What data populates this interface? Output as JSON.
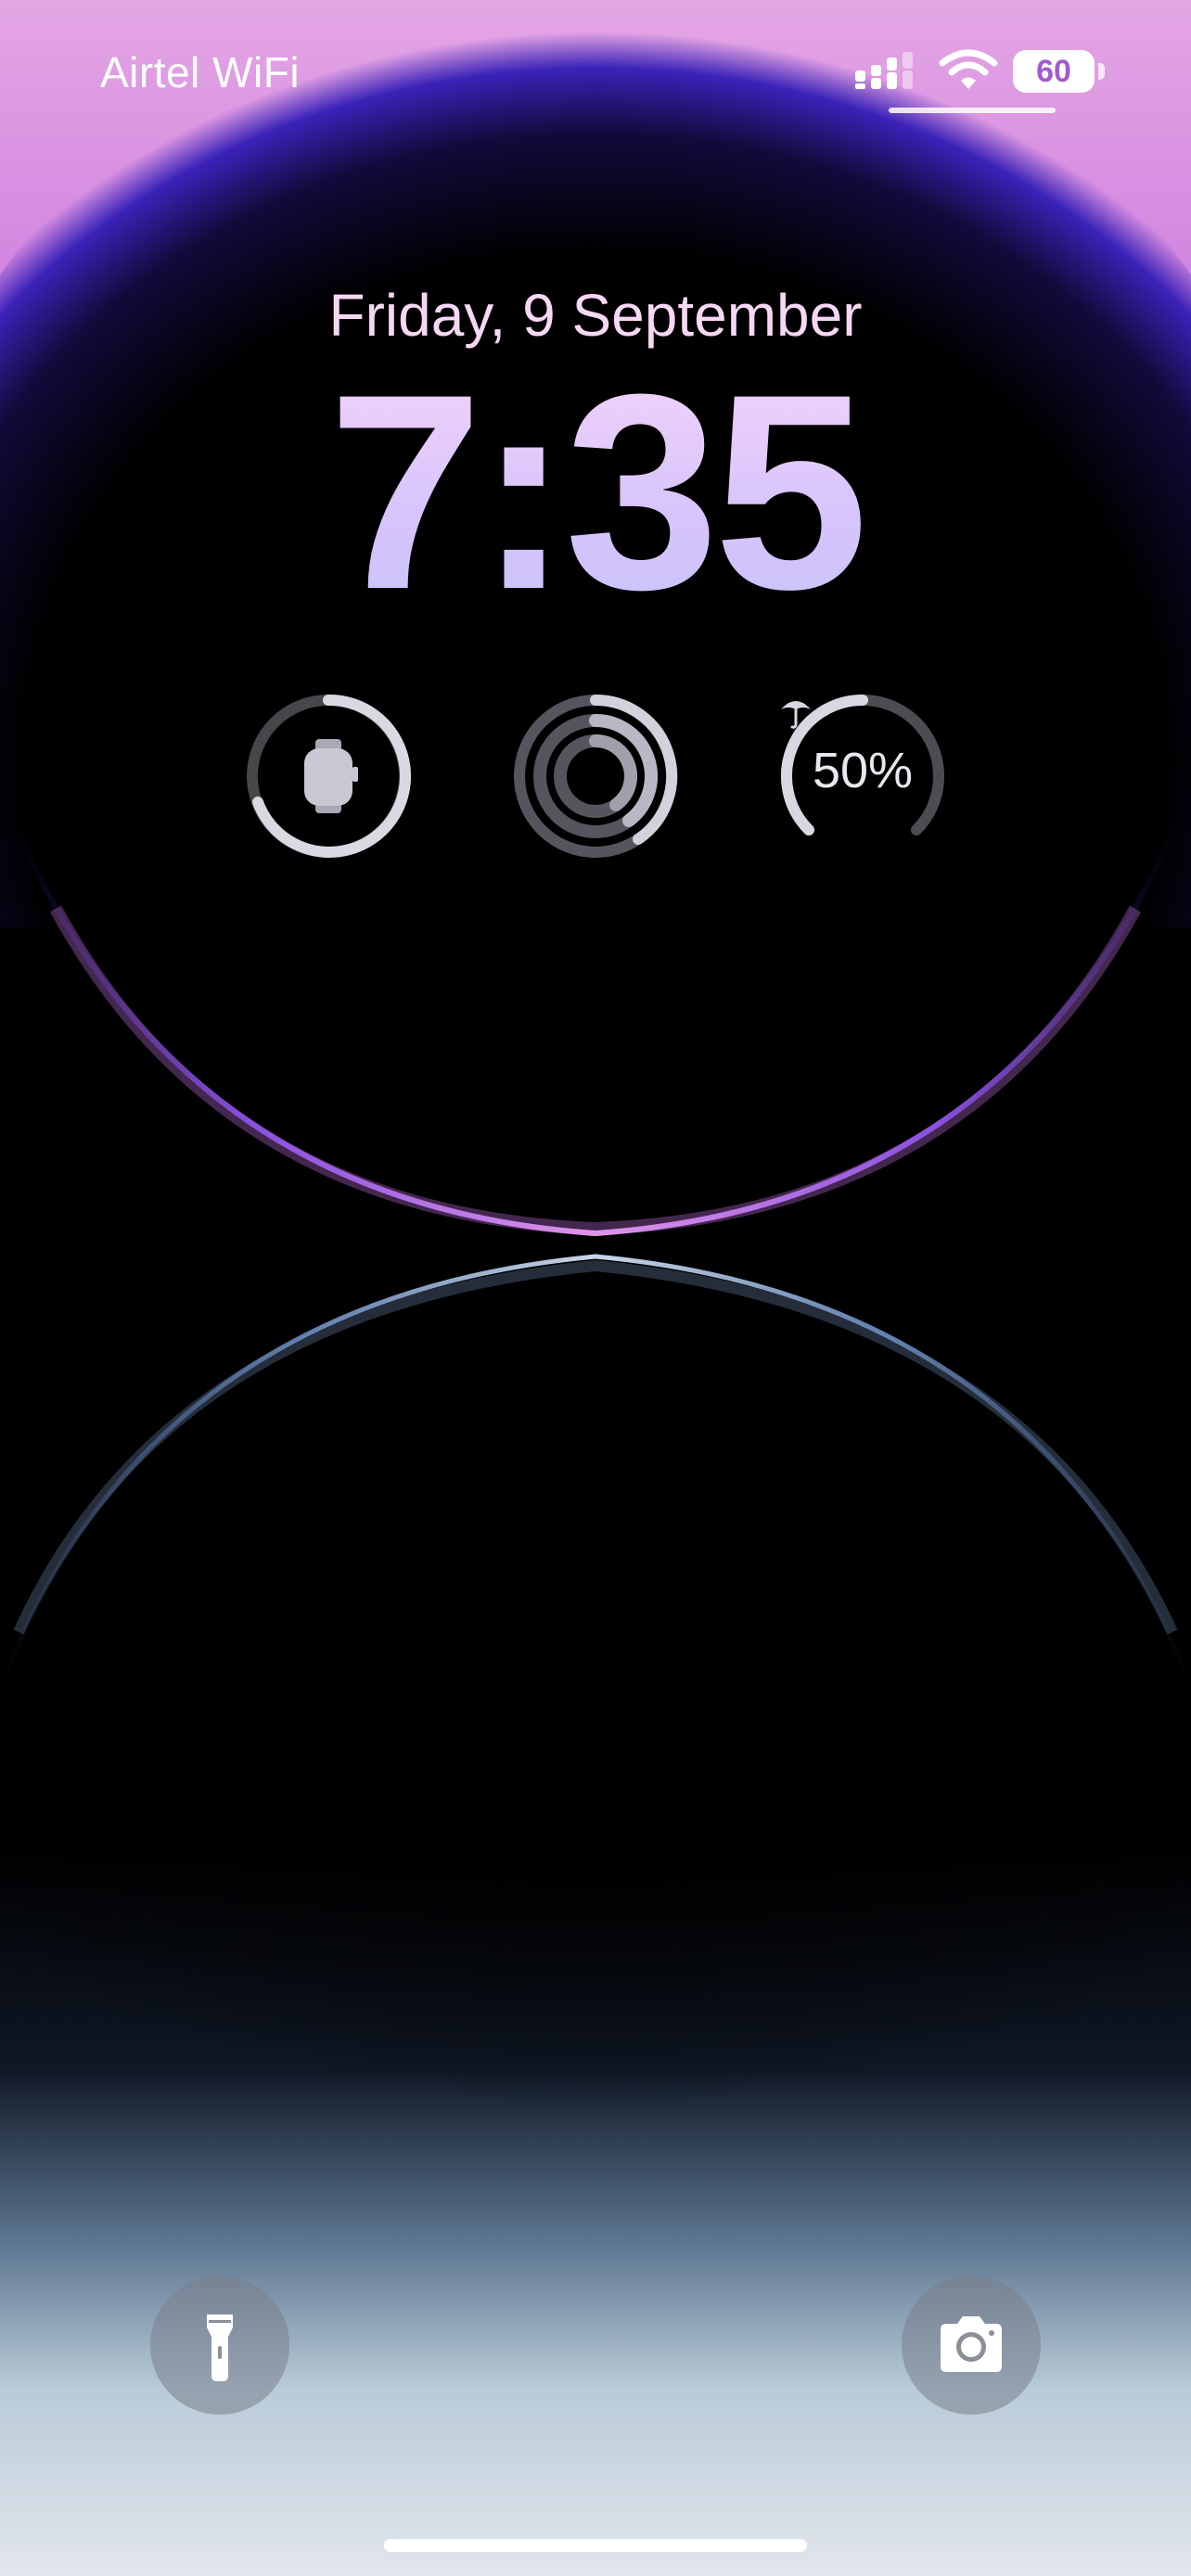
{
  "status_bar": {
    "carrier": "Airtel WiFi",
    "battery_level": "60",
    "icons": [
      "cellular-signal-icon",
      "wifi-icon",
      "battery-icon"
    ]
  },
  "lock_screen": {
    "date": "Friday, 9 September",
    "time": "7:35"
  },
  "widgets": [
    {
      "name": "watch-battery",
      "icon": "apple-watch-icon"
    },
    {
      "name": "activity-rings",
      "icon": "activity-rings-icon"
    },
    {
      "name": "rain-chance",
      "value": "50%",
      "icon": "umbrella-icon"
    }
  ],
  "buttons": [
    {
      "name": "flashlight",
      "icon": "flashlight-icon"
    },
    {
      "name": "camera",
      "icon": "camera-icon"
    }
  ],
  "colors": {
    "accent_purple": "#8c3fe0",
    "date_text": "#f6d8f4",
    "time_text": "#d6c4fb"
  }
}
